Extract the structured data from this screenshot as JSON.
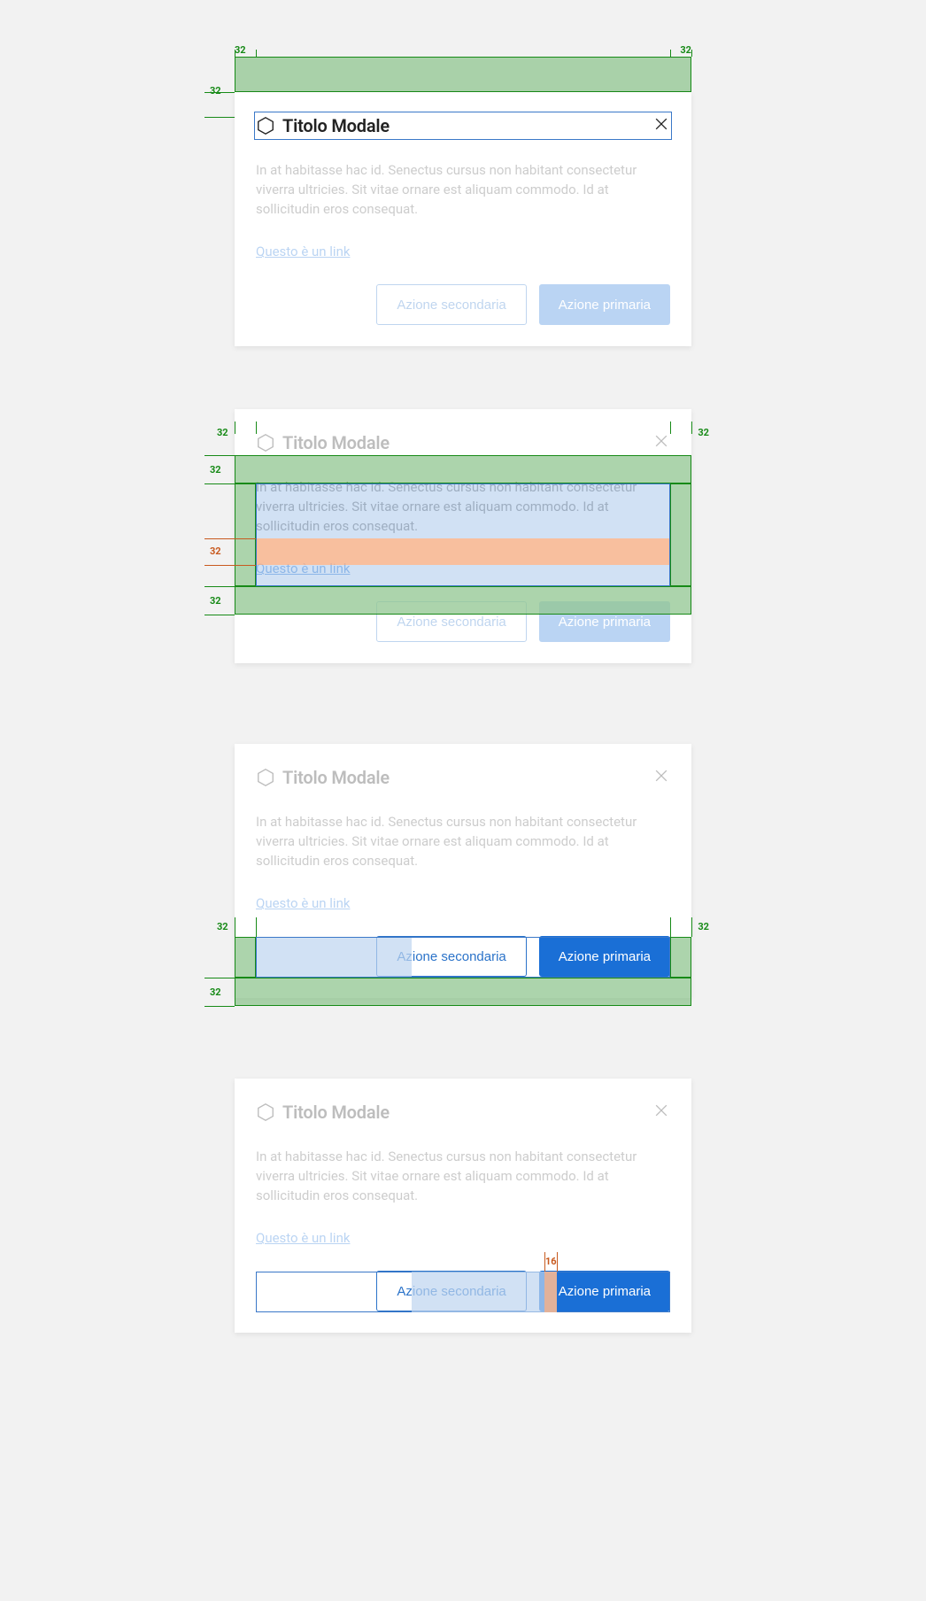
{
  "modal": {
    "title": "Titolo Modale",
    "body": "In at habitasse hac id. Senectus cursus non habitant consectetur viverra ultricies. Sit vitae ornare est aliquam commodo. Id at sollicitudin eros consequat.",
    "link": "Questo è un link",
    "secondary": "Azione secondaria",
    "primary": "Azione primaria"
  },
  "measures": {
    "s32": "32",
    "s16": "16"
  }
}
